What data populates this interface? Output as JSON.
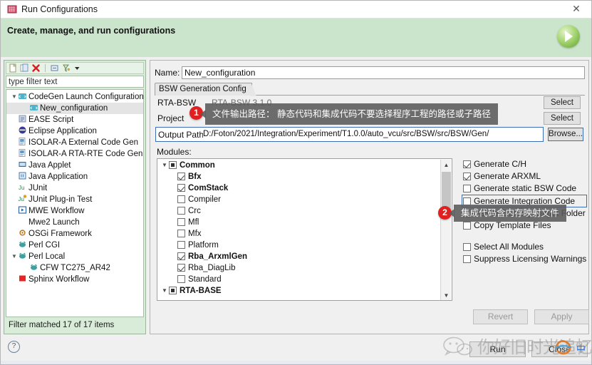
{
  "window": {
    "title": "Run Configurations",
    "close_label": "✕",
    "icon": "run-configurations-icon"
  },
  "banner": {
    "title": "Create, manage, and run configurations",
    "run_icon": "green-play-icon",
    "bg_color": "#cbe5cd"
  },
  "left_panel": {
    "toolbar_icons": [
      "new-configuration-icon",
      "duplicate-icon",
      "delete-icon",
      "collapse-all-icon",
      "filter-icon",
      "view-menu-chevron-icon"
    ],
    "filter": {
      "value": "type filter text",
      "placeholder": "type filter text"
    },
    "status": "Filter matched 17 of 17 items",
    "tree": [
      {
        "label": "CodeGen Launch Configuration",
        "level": 1,
        "expanded": true,
        "icon": "codegen-icon",
        "selected": false
      },
      {
        "label": "New_configuration",
        "level": 2,
        "expanded": null,
        "icon": "codegen-icon",
        "selected": true
      },
      {
        "label": "EASE Script",
        "level": 1,
        "expanded": null,
        "icon": "ease-script-icon",
        "selected": false
      },
      {
        "label": "Eclipse Application",
        "level": 1,
        "expanded": null,
        "icon": "eclipse-icon",
        "selected": false
      },
      {
        "label": "ISOLAR-A External Code Gen",
        "level": 1,
        "expanded": null,
        "icon": "isolar-icon",
        "selected": false
      },
      {
        "label": "ISOLAR-A RTA-RTE Code Gen",
        "level": 1,
        "expanded": null,
        "icon": "isolar-icon",
        "selected": false
      },
      {
        "label": "Java Applet",
        "level": 1,
        "expanded": null,
        "icon": "java-applet-icon",
        "selected": false
      },
      {
        "label": "Java Application",
        "level": 1,
        "expanded": null,
        "icon": "java-application-icon",
        "selected": false
      },
      {
        "label": "JUnit",
        "level": 1,
        "expanded": null,
        "icon": "junit-icon",
        "selected": false
      },
      {
        "label": "JUnit Plug-in Test",
        "level": 1,
        "expanded": null,
        "icon": "junit-plugin-icon",
        "selected": false
      },
      {
        "label": "MWE Workflow",
        "level": 1,
        "expanded": null,
        "icon": "mwe-workflow-icon",
        "selected": false
      },
      {
        "label": "Mwe2 Launch",
        "level": 1,
        "expanded": null,
        "icon": "none",
        "selected": false
      },
      {
        "label": "OSGi Framework",
        "level": 1,
        "expanded": null,
        "icon": "osgi-icon",
        "selected": false
      },
      {
        "label": "Perl CGI",
        "level": 1,
        "expanded": null,
        "icon": "perl-icon",
        "selected": false
      },
      {
        "label": "Perl Local",
        "level": 1,
        "expanded": true,
        "icon": "perl-icon",
        "selected": false
      },
      {
        "label": "CFW TC275_AR42",
        "level": 2,
        "expanded": null,
        "icon": "perl-icon",
        "selected": false
      },
      {
        "label": "Sphinx Workflow",
        "level": 1,
        "expanded": null,
        "icon": "sphinx-icon",
        "selected": false
      }
    ]
  },
  "main": {
    "name_label": "Name:",
    "name_value": "New_configuration",
    "tab_label": "BSW Generation Config",
    "rows": [
      {
        "label": "RTA-BSW",
        "value": "RTA-BSW 3.1.0",
        "button": "Select"
      },
      {
        "label": "Project",
        "value": "",
        "button": "Select"
      }
    ],
    "output_path_label": "Output Path",
    "output_path_value": "D:/Foton/2021/Integration/Experiment/T1.0.0/auto_vcu/src/BSW/src/BSW/Gen/",
    "browse_label": "Browse...",
    "modules_label": "Modules:",
    "modules": [
      {
        "label": "Common",
        "level": 1,
        "state": "partial",
        "bold": true,
        "expanded": true
      },
      {
        "label": "Bfx",
        "level": 2,
        "state": "checked",
        "bold": true,
        "expanded": null
      },
      {
        "label": "ComStack",
        "level": 2,
        "state": "checked",
        "bold": true,
        "expanded": null
      },
      {
        "label": "Compiler",
        "level": 2,
        "state": "unchecked",
        "bold": false,
        "expanded": null
      },
      {
        "label": "Crc",
        "level": 2,
        "state": "unchecked",
        "bold": false,
        "expanded": null
      },
      {
        "label": "Mfl",
        "level": 2,
        "state": "unchecked",
        "bold": false,
        "expanded": null
      },
      {
        "label": "Mfx",
        "level": 2,
        "state": "unchecked",
        "bold": false,
        "expanded": null
      },
      {
        "label": "Platform",
        "level": 2,
        "state": "unchecked",
        "bold": false,
        "expanded": null
      },
      {
        "label": "Rba_ArxmlGen",
        "level": 2,
        "state": "checked",
        "bold": true,
        "expanded": null
      },
      {
        "label": "Rba_DiagLib",
        "level": 2,
        "state": "checked",
        "bold": false,
        "expanded": null
      },
      {
        "label": "Standard",
        "level": 2,
        "state": "unchecked",
        "bold": false,
        "expanded": null
      },
      {
        "label": "RTA-BASE",
        "level": 1,
        "state": "partial",
        "bold": true,
        "expanded": true
      }
    ],
    "options": [
      {
        "label": "Generate C/H",
        "state": "checked",
        "focused": false
      },
      {
        "label": "Generate ARXML",
        "state": "checked",
        "focused": false
      },
      {
        "label": "Generate static BSW Code",
        "state": "unchecked",
        "focused": false
      },
      {
        "label": "Generate Integration Code",
        "state": "unchecked",
        "focused": true
      },
      {
        "label": "Delete Existing Output Folder",
        "state": "unchecked",
        "focused": false
      },
      {
        "label": "Copy Template Files",
        "state": "unchecked",
        "focused": false
      }
    ],
    "options_extra": [
      {
        "label": "Select All Modules",
        "state": "unchecked"
      },
      {
        "label": "Suppress Licensing Warnings",
        "state": "unchecked"
      }
    ],
    "revert_label": "Revert",
    "apply_label": "Apply"
  },
  "footer": {
    "help_icon": "question-mark-icon",
    "run_label": "Run",
    "close_label": "Close"
  },
  "annotations": [
    {
      "number": "1",
      "text": "文件输出路径： 静态代码和集成代码不要选择程序工程的路径或子路径"
    },
    {
      "number": "2",
      "text": "集成代码含内存映射文件"
    }
  ],
  "watermark": {
    "text": "你好旧时光追忆",
    "wechat_icon": "wechat-icon",
    "ime_label": "中",
    "browser_icon": "ie-browser-icon"
  }
}
